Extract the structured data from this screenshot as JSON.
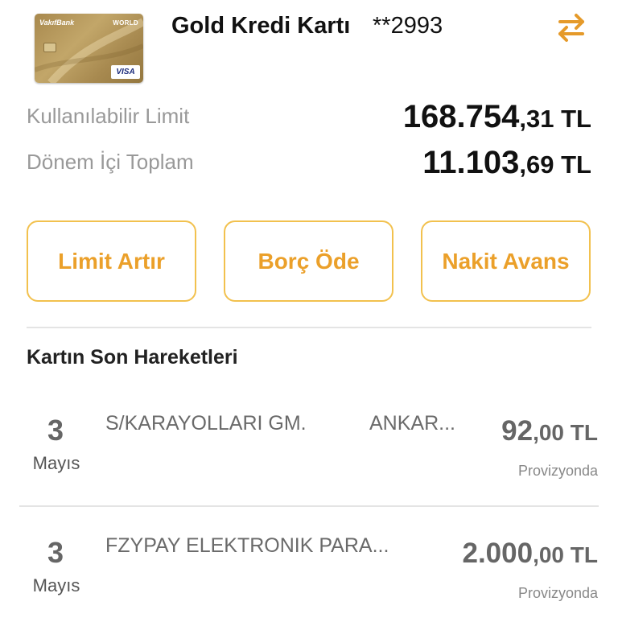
{
  "card": {
    "bank_name": "VakıfBank",
    "tier": "WORLD",
    "network": "VISA",
    "title": "Gold Kredi Kartı",
    "number_masked": "**2993",
    "accent_color": "#eba02a"
  },
  "limits": {
    "available_label": "Kullanılabilir Limit",
    "available_int": "168.754",
    "available_dec": ",31 TL",
    "period_label": "Dönem İçi Toplam",
    "period_int": "11.103",
    "period_dec": ",69 TL"
  },
  "actions": {
    "limit_increase": "Limit Artır",
    "pay_debt": "Borç Öde",
    "cash_advance": "Nakit Avans"
  },
  "transactions": {
    "title": "Kartın Son Hareketleri",
    "items": [
      {
        "day": "3",
        "month": "Mayıs",
        "description": "S/KARAYOLLARI GM.",
        "location": "ANKAR...",
        "amount_int": "92",
        "amount_dec": ",00 TL",
        "status": "Provizyonda"
      },
      {
        "day": "3",
        "month": "Mayıs",
        "description": "FZYPAY ELEKTRONIK PARA...",
        "location": "",
        "amount_int": "2.000",
        "amount_dec": ",00 TL",
        "status": "Provizyonda"
      }
    ]
  },
  "icons": {
    "swap": "swap-arrows-icon"
  }
}
